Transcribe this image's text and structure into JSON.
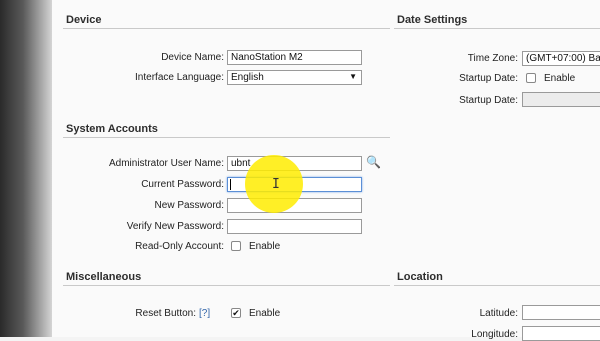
{
  "device": {
    "title": "Device",
    "device_name_label": "Device Name:",
    "device_name_value": "NanoStation M2",
    "language_label": "Interface Language:",
    "language_value": "English",
    "dropdown_arrow": "▼"
  },
  "date_settings": {
    "title": "Date Settings",
    "time_zone_label": "Time Zone:",
    "time_zone_value": "(GMT+07:00) Ba",
    "startup_date_label": "Startup Date:",
    "startup_enable_label": "Enable",
    "startup_date_field_label": "Startup Date:",
    "startup_date_value": ""
  },
  "system_accounts": {
    "title": "System Accounts",
    "admin_user_label": "Administrator User Name:",
    "admin_user_value": "ubnt",
    "current_password_label": "Current Password:",
    "current_password_value": "",
    "new_password_label": "New Password:",
    "new_password_value": "",
    "verify_password_label": "Verify New Password:",
    "verify_password_value": "",
    "readonly_label": "Read-Only Account:",
    "readonly_enable_label": "Enable"
  },
  "miscellaneous": {
    "title": "Miscellaneous",
    "reset_label": "Reset Button:",
    "reset_help": "[?]",
    "reset_checkmark": "✔",
    "reset_enable_label": "Enable"
  },
  "location": {
    "title": "Location",
    "latitude_label": "Latitude:",
    "latitude_value": "",
    "longitude_label": "Longitude:",
    "longitude_value": ""
  },
  "icons": {
    "search": "🔍",
    "text_cursor": "I"
  }
}
